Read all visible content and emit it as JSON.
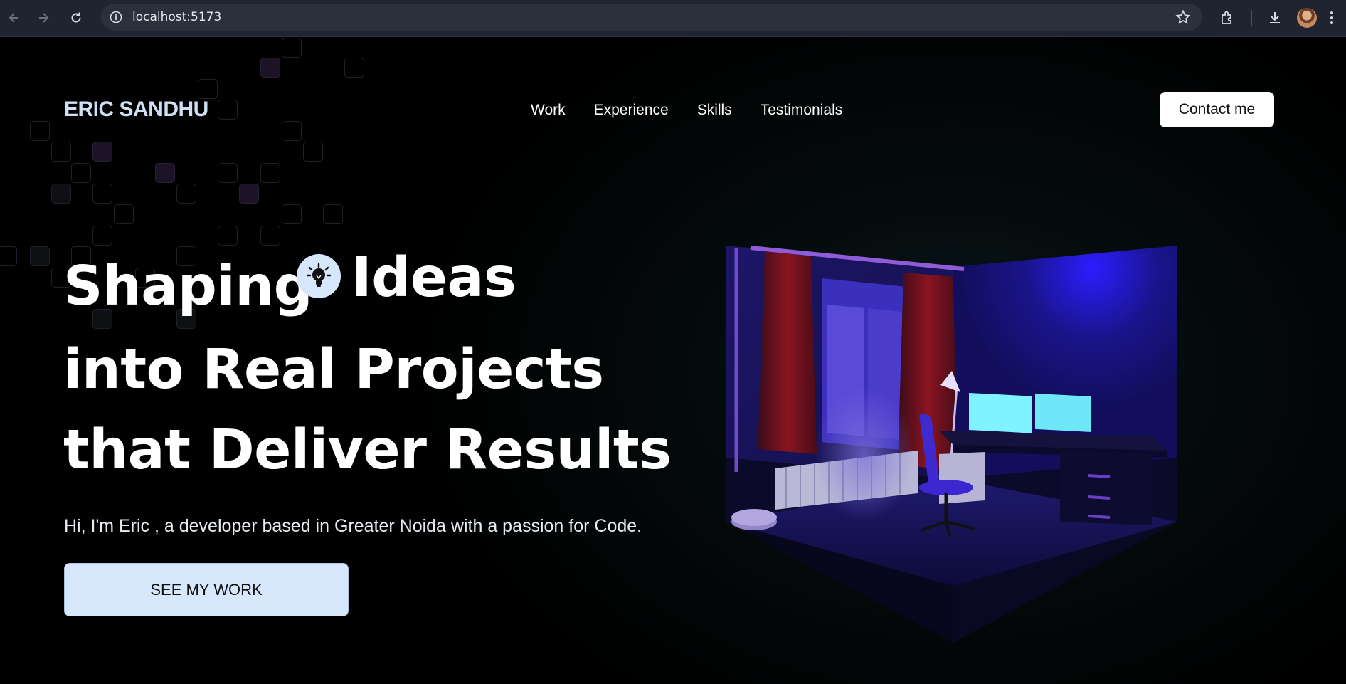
{
  "browser": {
    "url": "localhost:5173",
    "icons": [
      "back-arrow-icon",
      "forward-arrow-icon",
      "reload-icon",
      "site-info-icon",
      "bookmark-star-icon",
      "extensions-icon",
      "download-icon",
      "profile-avatar",
      "more-menu-icon"
    ]
  },
  "header": {
    "logo": "ERIC SANDHU",
    "nav": [
      "Work",
      "Experience",
      "Skills",
      "Testimonials"
    ],
    "contact_label": "Contact me"
  },
  "hero": {
    "line1_word1": "Shaping",
    "line1_word2": "Ideas",
    "line2": "into Real Projects",
    "line3": "that Deliver Results",
    "subtitle": "Hi, I'm Eric , a developer based in Greater Noida with a passion for Code.",
    "cta_label": "SEE MY WORK"
  },
  "colors": {
    "accent_light_blue": "#d7e8fd",
    "room_purple": "#2a1bb0",
    "monitor_cyan": "#7ff3ff"
  }
}
